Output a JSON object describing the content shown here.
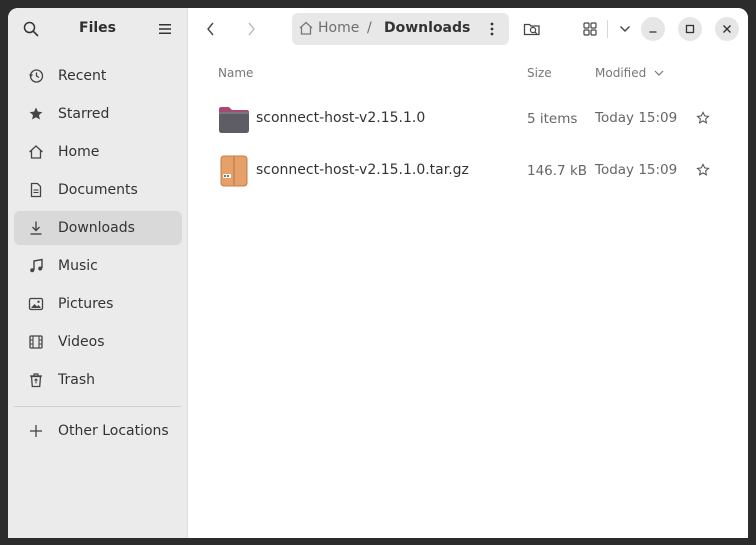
{
  "sidebar": {
    "title": "Files",
    "items": [
      {
        "label": "Recent",
        "icon": "clock-icon"
      },
      {
        "label": "Starred",
        "icon": "star-icon"
      },
      {
        "label": "Home",
        "icon": "home-icon"
      },
      {
        "label": "Documents",
        "icon": "document-icon"
      },
      {
        "label": "Downloads",
        "icon": "download-icon",
        "active": true
      },
      {
        "label": "Music",
        "icon": "music-note-icon"
      },
      {
        "label": "Pictures",
        "icon": "picture-icon"
      },
      {
        "label": "Videos",
        "icon": "film-icon"
      },
      {
        "label": "Trash",
        "icon": "trash-icon"
      }
    ],
    "other_locations": "Other Locations"
  },
  "pathbar": {
    "home": "Home",
    "separator": "/",
    "current": "Downloads"
  },
  "columns": {
    "name": "Name",
    "size": "Size",
    "modified": "Modified"
  },
  "files": [
    {
      "name": "sconnect-host-v2.15.1.0",
      "size": "5 items",
      "modified": "Today 15:09",
      "icon": "folder-icon"
    },
    {
      "name": "sconnect-host-v2.15.1.0.tar.gz",
      "size": "146.7 kB",
      "modified": "Today 15:09",
      "icon": "archive-icon"
    }
  ],
  "colors": {
    "sidebar_bg": "#ebebeb",
    "active_item": "#d9d9d9",
    "pathbar_bg": "#e8e8e8",
    "folder_body": "#5e5c64",
    "folder_tab": "#a64a74",
    "archive": "#e6a06a"
  }
}
